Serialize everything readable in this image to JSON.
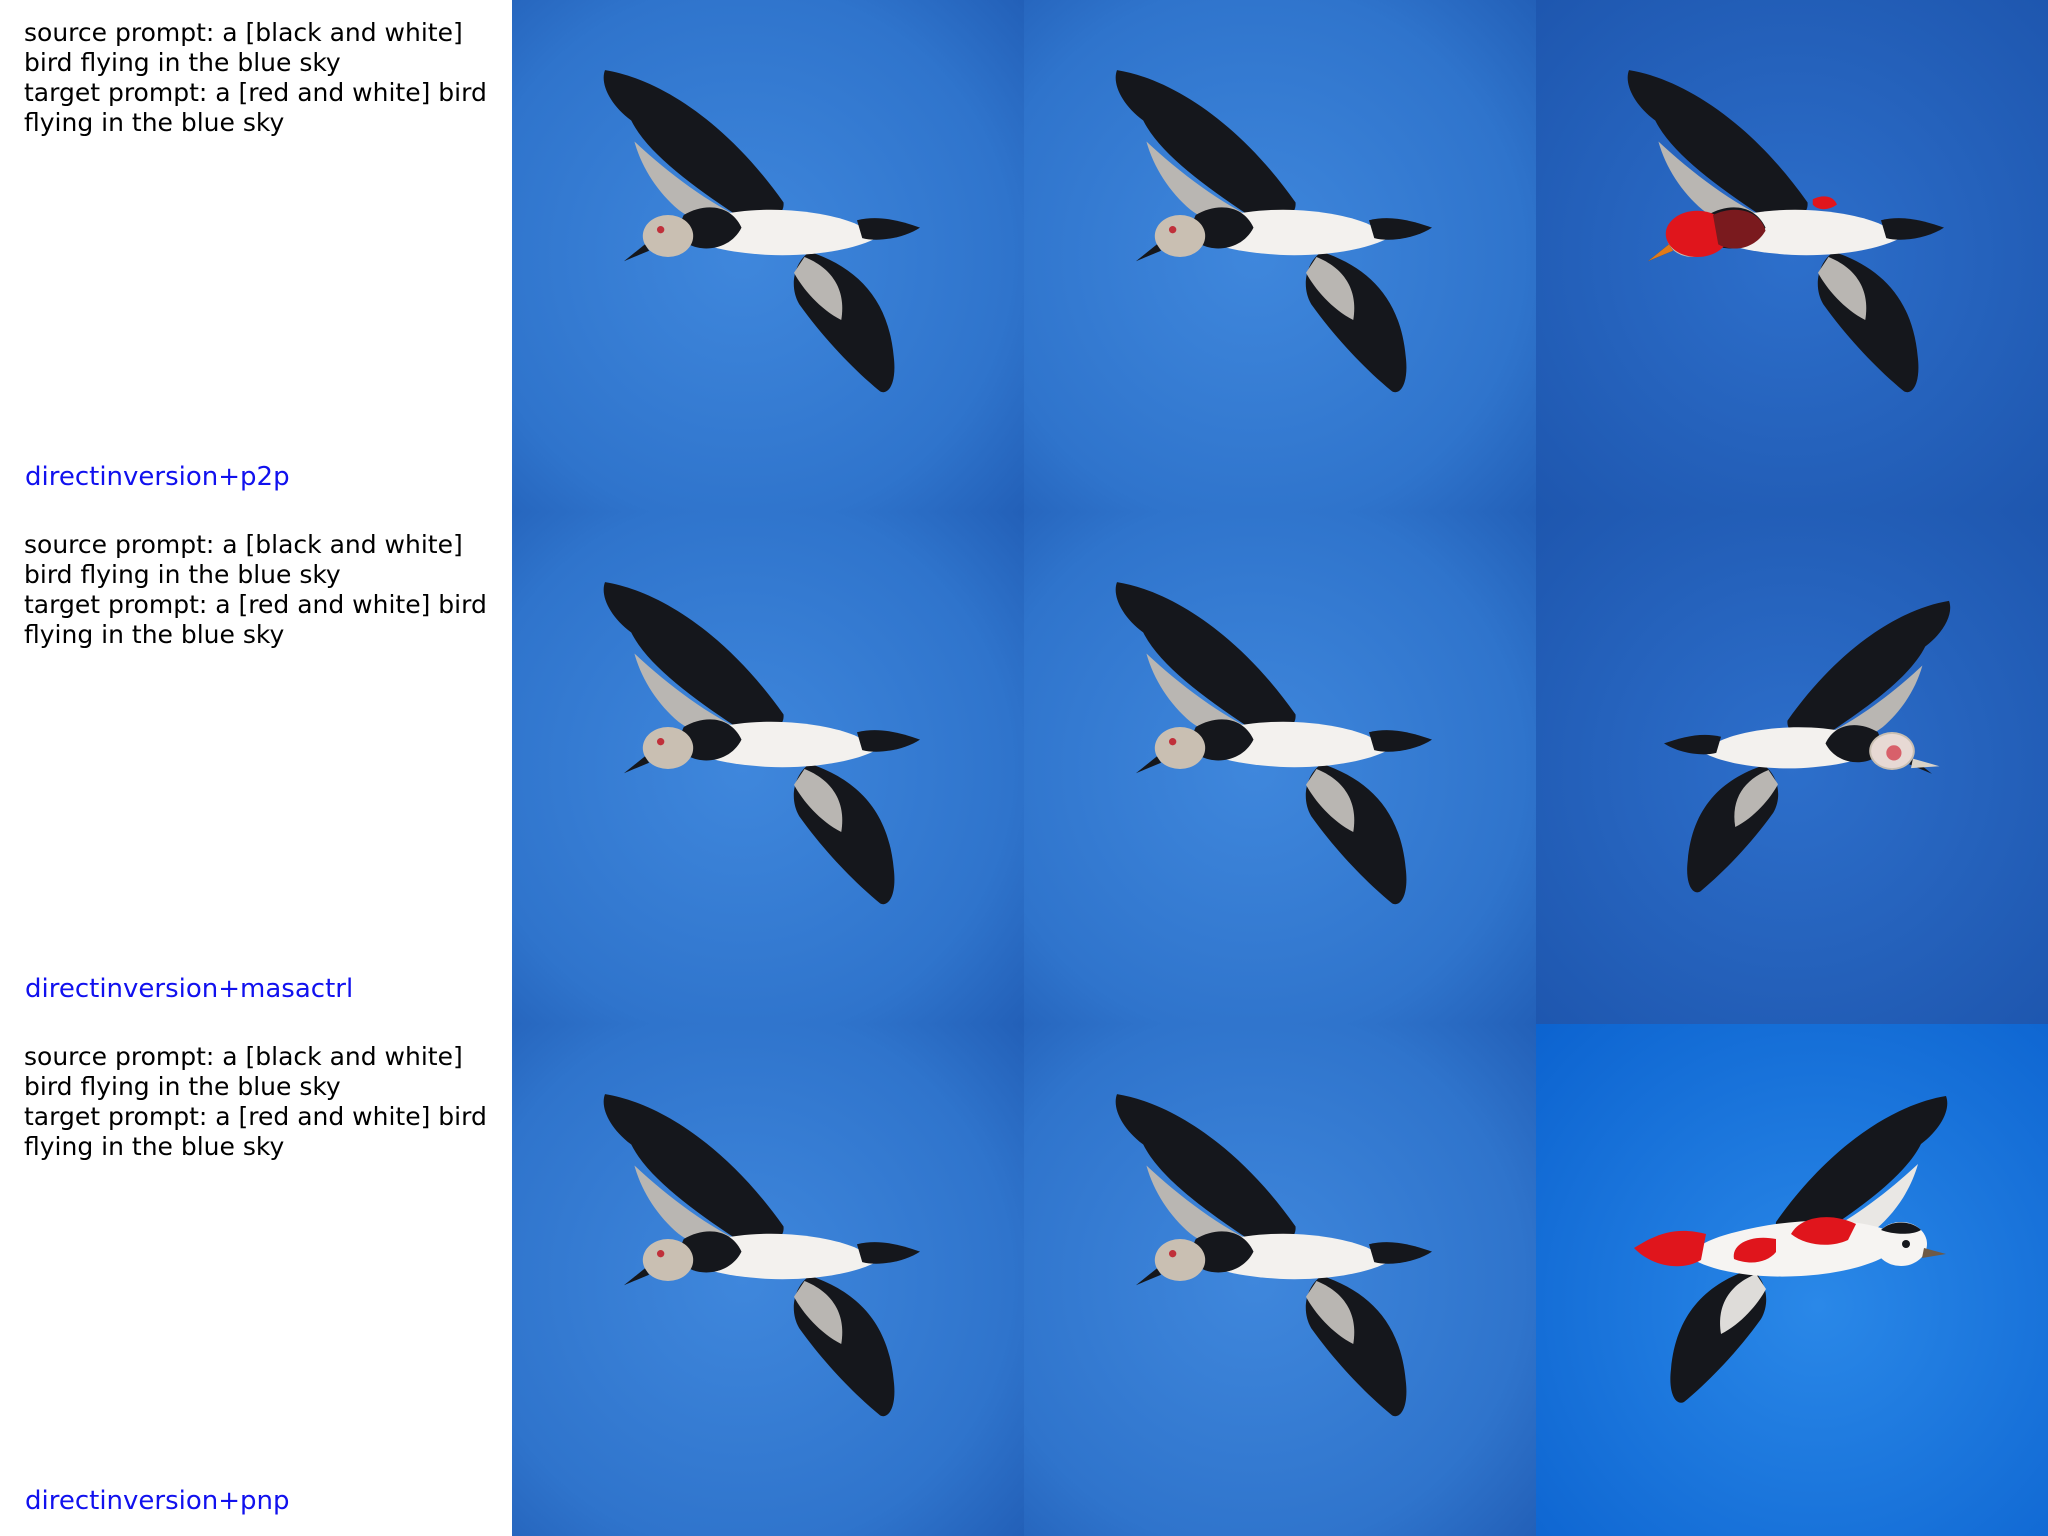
{
  "layout": {
    "columns": 4,
    "rows": 3
  },
  "colors": {
    "method_label": "#1111ee",
    "sky_light": "#3a80d6",
    "sky_dark": "#1f5db8",
    "sky_bright": "#2e85e4",
    "bird_black": "#15171c",
    "bird_white": "#f3f1ee",
    "bird_gray": "#b9b6b2",
    "bird_red": "#e0151c"
  },
  "rows": [
    {
      "source_prompt_line1": "source prompt: a [black and white]",
      "source_prompt_line2": "bird flying in the blue sky",
      "target_prompt_line1": "target prompt: a [red and white] bird",
      "target_prompt_line2": "flying in the blue sky",
      "method": "directinversion+p2p",
      "images": [
        {
          "subject": "bird-photo",
          "variant": "source"
        },
        {
          "subject": "bird-photo",
          "variant": "reconstruction"
        },
        {
          "subject": "bird-photo",
          "variant": "edited-red-head"
        }
      ]
    },
    {
      "source_prompt_line1": "source prompt: a [black and white]",
      "source_prompt_line2": "bird flying in the blue sky",
      "target_prompt_line1": "target prompt: a [red and white] bird",
      "target_prompt_line2": "flying in the blue sky",
      "method": "directinversion+masactrl",
      "images": [
        {
          "subject": "bird-photo",
          "variant": "source"
        },
        {
          "subject": "bird-photo",
          "variant": "reconstruction"
        },
        {
          "subject": "bird-photo",
          "variant": "edited-flipped"
        }
      ]
    },
    {
      "source_prompt_line1": "source prompt: a [black and white]",
      "source_prompt_line2": "bird flying in the blue sky",
      "target_prompt_line1": "target prompt: a [red and white] bird",
      "target_prompt_line2": "flying in the blue sky",
      "method": "directinversion+pnp",
      "images": [
        {
          "subject": "bird-photo",
          "variant": "source"
        },
        {
          "subject": "bird-photo",
          "variant": "reconstruction"
        },
        {
          "subject": "bird-photo",
          "variant": "edited-red-white"
        }
      ]
    }
  ]
}
